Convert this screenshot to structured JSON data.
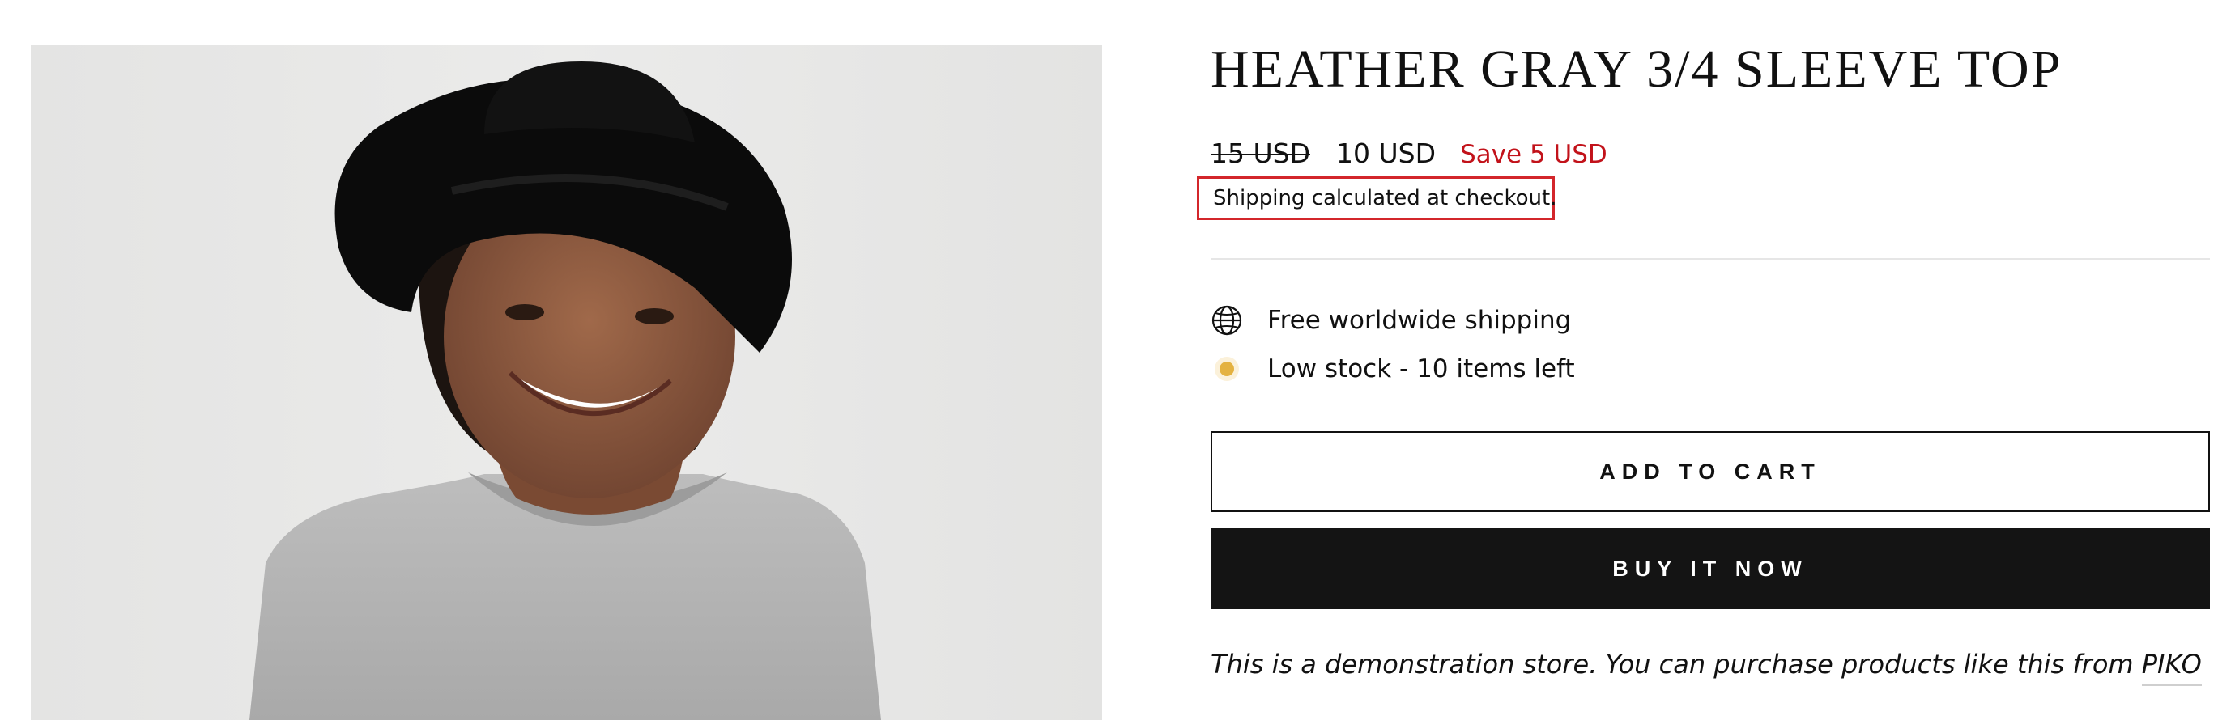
{
  "product": {
    "title": "HEATHER GRAY 3/4 SLEEVE TOP",
    "image_alt": "Woman wearing a black wide-brim hat and a heather gray 3/4 sleeve top"
  },
  "pricing": {
    "compare_at": "15 USD",
    "sale": "10 USD",
    "savings": "Save 5 USD",
    "sale_color": "#c2121a"
  },
  "shipping_note": "Shipping calculated at checkout.",
  "features": [
    {
      "icon": "globe-icon",
      "label": "Free worldwide shipping"
    },
    {
      "icon": "stock-dot-icon",
      "label": "Low stock - 10 items left"
    }
  ],
  "actions": {
    "add_to_cart": "ADD TO CART",
    "buy_now": "BUY IT NOW"
  },
  "demo_notice": {
    "text": "This is a demonstration store. You can purchase products like this from ",
    "link_label": "PIKO"
  },
  "colors": {
    "highlight_border": "#d3262b",
    "stock_indicator": "#e4b241",
    "buy_button_bg": "#141414"
  }
}
